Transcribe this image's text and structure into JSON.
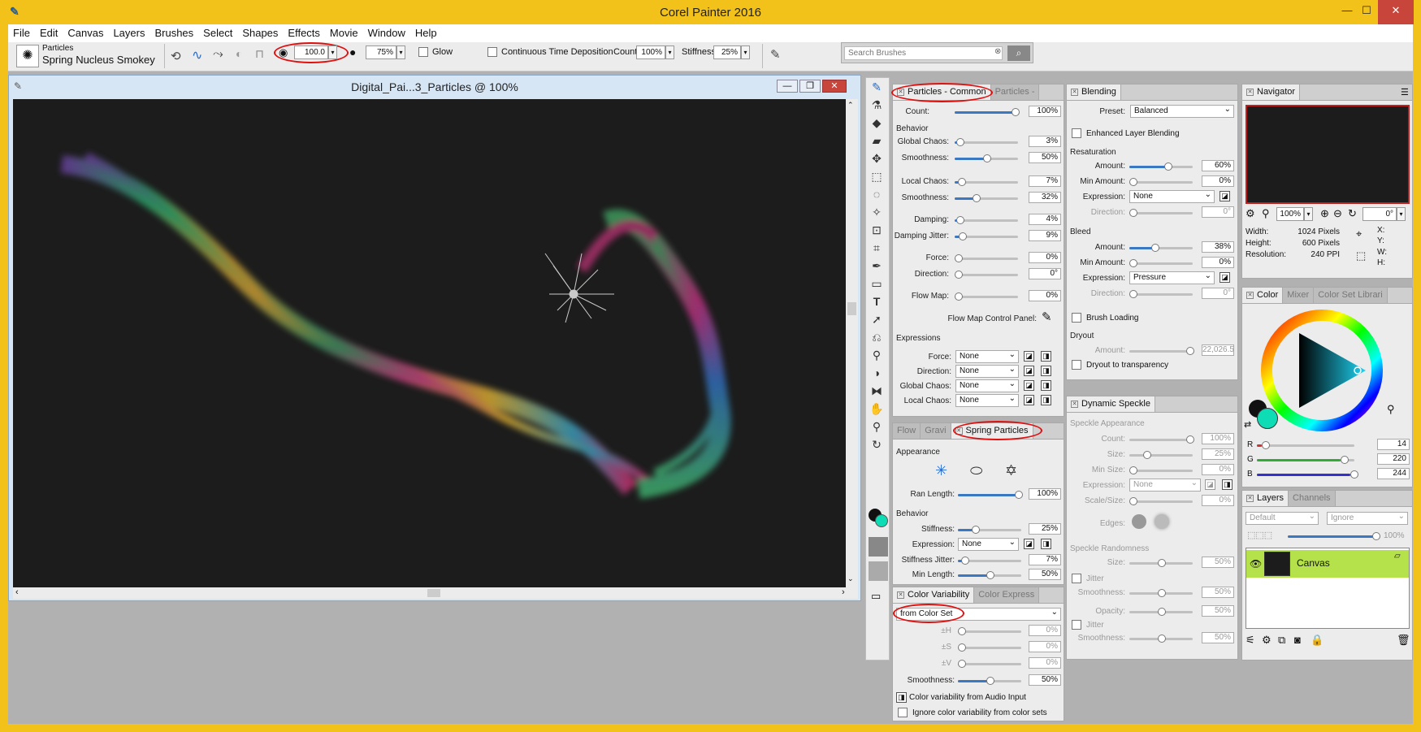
{
  "app": {
    "title": "Corel Painter 2016",
    "minimize": "—",
    "maximize": "☐",
    "close": "✕"
  },
  "menu": [
    "File",
    "Edit",
    "Canvas",
    "Layers",
    "Brushes",
    "Select",
    "Shapes",
    "Effects",
    "Movie",
    "Window",
    "Help"
  ],
  "brush": {
    "category": "Particles",
    "variant": "Spring Nucleus Smokey"
  },
  "propbar": {
    "size": "100.0",
    "opacity": "75%",
    "glow_label": "Glow",
    "ctd_label": "Continuous Time Deposition",
    "count_label": "Count:",
    "count": "100%",
    "stiffness_label": "Stiffness:",
    "stiffness": "25%",
    "search_placeholder": "Search Brushes"
  },
  "document": {
    "title": "Digital_Pai...3_Particles @ 100%"
  },
  "particles_common": {
    "tabs": [
      "Particles - Common",
      "Particles -"
    ],
    "count_label": "Count:",
    "count": "100%",
    "behavior_label": "Behavior",
    "global_chaos_label": "Global Chaos:",
    "global_chaos": "3%",
    "smoothness1_label": "Smoothness:",
    "smoothness1": "50%",
    "local_chaos_label": "Local Chaos:",
    "local_chaos": "7%",
    "smoothness2_label": "Smoothness:",
    "smoothness2": "32%",
    "damping_label": "Damping:",
    "damping": "4%",
    "damping_jitter_label": "Damping Jitter:",
    "damping_jitter": "9%",
    "force_label": "Force:",
    "force": "0%",
    "direction_label": "Direction:",
    "direction": "0°",
    "flow_map_label": "Flow Map:",
    "flow_map": "0%",
    "flow_map_panel_label": "Flow Map Control Panel:",
    "expressions_label": "Expressions",
    "exp_force_label": "Force:",
    "exp_direction_label": "Direction:",
    "exp_global_chaos_label": "Global Chaos:",
    "exp_local_chaos_label": "Local Chaos:",
    "none": "None"
  },
  "spring": {
    "tabs": [
      "Flow",
      "Gravi",
      "Spring Particles"
    ],
    "appearance_label": "Appearance",
    "ran_length_label": "Ran Length:",
    "ran_length": "100%",
    "behavior_label": "Behavior",
    "stiffness_label": "Stiffness:",
    "stiffness": "25%",
    "expression_label": "Expression:",
    "expression": "None",
    "stiffness_jitter_label": "Stiffness Jitter:",
    "stiffness_jitter": "7%",
    "min_length_label": "Min Length:",
    "min_length": "50%"
  },
  "color_var": {
    "tabs": [
      "Color Variability",
      "Color Express"
    ],
    "mode": "from Color Set",
    "h_label": "±H",
    "h": "0%",
    "s_label": "±S",
    "s": "0%",
    "v_label": "±V",
    "v": "0%",
    "smoothness_label": "Smoothness:",
    "smoothness": "50%",
    "audio_label": "Color variability from Audio Input",
    "ignore_label": "Ignore color variability from color sets"
  },
  "blending": {
    "tab": "Blending",
    "preset_label": "Preset:",
    "preset": "Balanced",
    "enhanced_label": "Enhanced Layer Blending",
    "resaturation_label": "Resaturation",
    "amount_label": "Amount:",
    "amount": "60%",
    "min_amount_label": "Min Amount:",
    "min_amount": "0%",
    "expression_label": "Expression:",
    "expression": "None",
    "direction_label": "Direction:",
    "direction": "0°",
    "bleed_label": "Bleed",
    "bleed_amount": "38%",
    "bleed_min": "0%",
    "bleed_expression": "Pressure",
    "bleed_direction": "0°",
    "brush_loading_label": "Brush Loading",
    "dryout_label": "Dryout",
    "dryout_amount": "22,026.5",
    "dryout_transparency_label": "Dryout to transparency"
  },
  "dynamic_speckle": {
    "tab": "Dynamic Speckle",
    "appearance_label": "Speckle Appearance",
    "count_label": "Count:",
    "count": "100%",
    "size_label": "Size:",
    "size": "25%",
    "min_size_label": "Min Size:",
    "min_size": "0%",
    "expression_label": "Expression:",
    "expression": "None",
    "scale_label": "Scale/Size:",
    "scale": "0%",
    "edges_label": "Edges:",
    "randomness_label": "Speckle Randomness",
    "r_size_label": "Size:",
    "r_size": "50%",
    "jitter_label": "Jitter",
    "smoothness_label": "Smoothness:",
    "smoothness": "50%",
    "opacity_label": "Opacity:",
    "opacity": "50%",
    "jitter2_label": "Jitter",
    "smoothness2": "50%"
  },
  "navigator": {
    "tab": "Navigator",
    "zoom": "100%",
    "rotation": "0°",
    "width_label": "Width:",
    "width": "1024 Pixels",
    "height_label": "Height:",
    "height": "600 Pixels",
    "resolution_label": "Resolution:",
    "resolution": "240 PPI",
    "x_label": "X:",
    "y_label": "Y:",
    "w_label": "W:",
    "h_label": "H:"
  },
  "color": {
    "tabs": [
      "Color",
      "Mixer",
      "Color Set Librari"
    ],
    "r_label": "R",
    "r": "14",
    "g_label": "G",
    "g": "220",
    "b_label": "B",
    "b": "244"
  },
  "layers": {
    "tabs": [
      "Layers",
      "Channels"
    ],
    "composite": "Default",
    "depth": "Ignore",
    "opacity": "100%",
    "layer_name": "Canvas"
  }
}
